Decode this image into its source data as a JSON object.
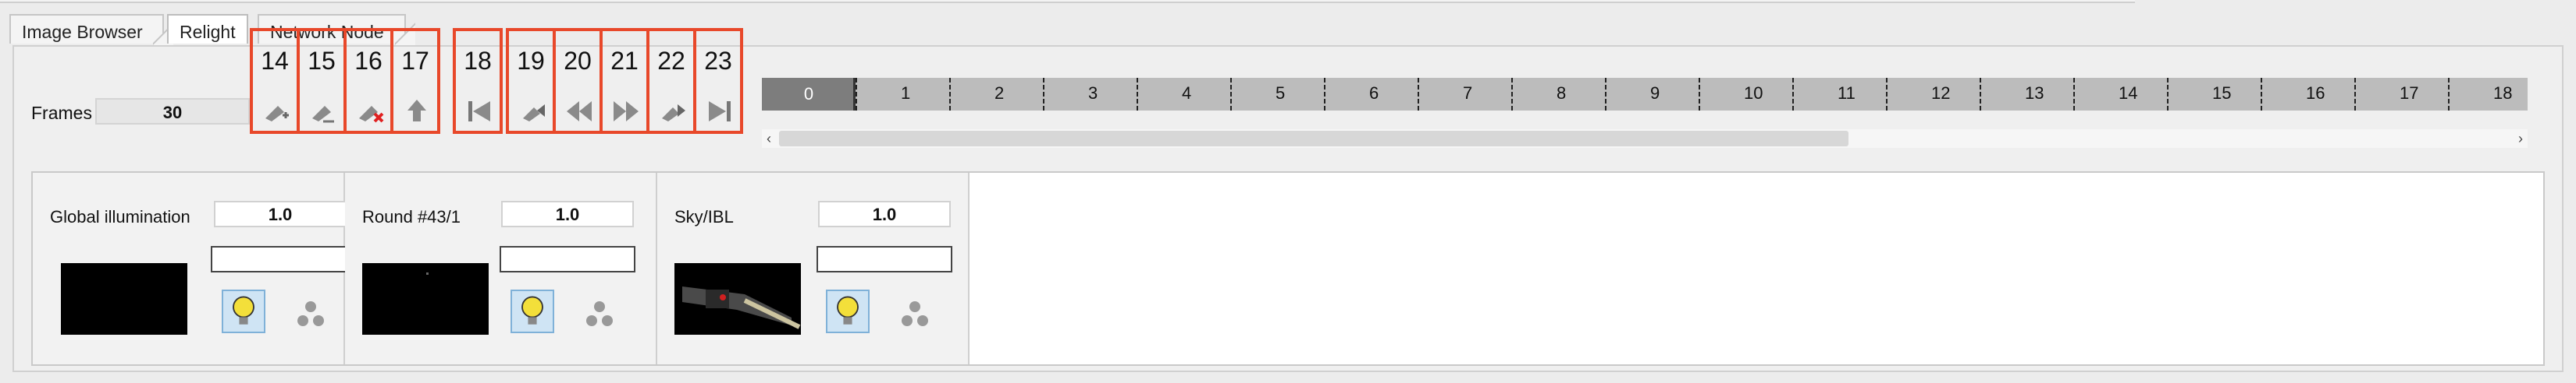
{
  "tabs": [
    {
      "label": "Image Browser"
    },
    {
      "label": "Relight",
      "active": true
    },
    {
      "label": "Network Node"
    }
  ],
  "frames": {
    "label": "Frames",
    "value": "30"
  },
  "toolbar": [
    {
      "num": "14",
      "icon": "key-add-icon"
    },
    {
      "num": "15",
      "icon": "key-icon"
    },
    {
      "num": "16",
      "icon": "key-remove-icon"
    },
    {
      "num": "17",
      "icon": "up-arrow-icon"
    },
    {
      "num": "18",
      "icon": "first-frame-icon"
    },
    {
      "num": "19",
      "icon": "previous-key-icon"
    },
    {
      "num": "20",
      "icon": "rewind-icon"
    },
    {
      "num": "21",
      "icon": "fast-forward-icon"
    },
    {
      "num": "22",
      "icon": "next-key-icon"
    },
    {
      "num": "23",
      "icon": "last-frame-icon"
    }
  ],
  "timeline": {
    "current": "0",
    "ticks": [
      "1",
      "2",
      "3",
      "4",
      "5",
      "6",
      "7",
      "8",
      "9",
      "10",
      "11",
      "12",
      "13",
      "14",
      "15",
      "16",
      "17",
      "18"
    ]
  },
  "lights": [
    {
      "name": "Global illumination",
      "value": "1.0"
    },
    {
      "name": "Round #43/1",
      "value": "1.0"
    },
    {
      "name": "Sky/IBL",
      "value": "1.0"
    }
  ],
  "colors": {
    "highlight": "#e8482a",
    "timeline": "#bcbcbc"
  }
}
